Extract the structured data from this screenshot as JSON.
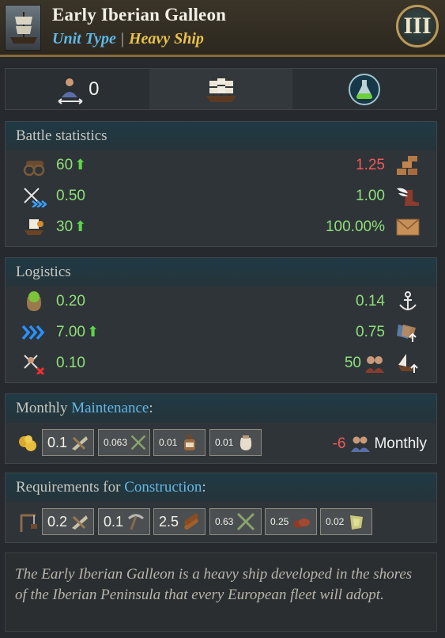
{
  "header": {
    "title": "Early Iberian Galleon",
    "unit_type_label": "Unit Type",
    "unit_type_value": "Heavy Ship",
    "tier": "III"
  },
  "topbar": {
    "crew_count": "0",
    "icons": [
      "crew-transfer-icon",
      "ship-icon",
      "potion-flask-icon"
    ]
  },
  "battle": {
    "title": "Battle statistics",
    "rows": [
      {
        "left_icon": "cannon-icon",
        "left": "60",
        "left_up": true,
        "right": "1.25",
        "right_red": true,
        "right_icon": "planks-icon"
      },
      {
        "left_icon": "crossed-swords-icon",
        "left": "0.50",
        "left_up": false,
        "right": "1.00",
        "right_red": false,
        "right_icon": "winged-boot-icon"
      },
      {
        "left_icon": "boarding-ship-icon",
        "left": "30",
        "left_up": true,
        "right": "100.00%",
        "right_red": false,
        "right_icon": "envelope-icon"
      }
    ]
  },
  "logistics": {
    "title": "Logistics",
    "rows": [
      {
        "left_icon": "supply-sack-icon",
        "left": "0.20",
        "left_up": false,
        "right": "0.14",
        "right_icon": "anchor-icon"
      },
      {
        "left_icon": "speed-chevrons-icon",
        "left": "7.00",
        "left_up": true,
        "right": "0.75",
        "right_icon": "sail-upgrade-icon"
      },
      {
        "left_icon": "attrition-icon",
        "left": "0.10",
        "left_up": false,
        "right": "50",
        "right_icon": "ship-upgrade-icon"
      }
    ]
  },
  "maintenance": {
    "title_prefix": "Monthly ",
    "title_highlight": "Maintenance",
    "title_suffix": ":",
    "chips": [
      {
        "value": "0.1",
        "icon": "hammer-saw-icon"
      },
      {
        "value": "0.063",
        "icon": "crossed-muskets-icon"
      },
      {
        "value": "0.01",
        "icon": "bottle-icon"
      },
      {
        "value": "0.01",
        "icon": "flour-sack-icon"
      }
    ],
    "pop_value": "-6",
    "pop_label": "Monthly"
  },
  "construction": {
    "title_prefix": "Requirements for ",
    "title_highlight": "Construction",
    "title_suffix": ":",
    "chips": [
      {
        "value": "0.2",
        "icon": "hammer-saw-icon"
      },
      {
        "value": "0.1",
        "icon": "pickaxe-icon"
      },
      {
        "value": "2.5",
        "icon": "timber-icon"
      },
      {
        "value": "0.63",
        "icon": "crossed-muskets-icon"
      },
      {
        "value": "0.25",
        "icon": "leather-icon"
      },
      {
        "value": "0.02",
        "icon": "cloth-icon"
      }
    ]
  },
  "description": "The Early Iberian Galleon is a heavy ship developed in the shores of the Iberian Peninsula that every European fleet will adopt.",
  "colors": {
    "positive": "#8ee07a",
    "negative": "#ef5a5a",
    "highlight": "#63b8e6",
    "unit_type": "#e9c24a"
  }
}
